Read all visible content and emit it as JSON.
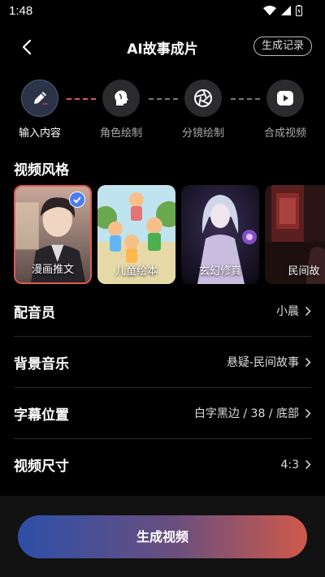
{
  "status_bar": {
    "time": "1:48"
  },
  "header": {
    "title": "AI故事成片",
    "history_label": "生成记录"
  },
  "steps": [
    {
      "label": "输入内容",
      "active": true
    },
    {
      "label": "角色绘制",
      "active": false
    },
    {
      "label": "分镜绘制",
      "active": false
    },
    {
      "label": "合成视频",
      "active": false
    }
  ],
  "video_style": {
    "title": "视频风格",
    "items": [
      {
        "label": "漫画推文",
        "selected": true
      },
      {
        "label": "儿童绘本",
        "selected": false
      },
      {
        "label": "玄幻修真",
        "selected": false
      },
      {
        "label": "民间故",
        "selected": false
      }
    ]
  },
  "settings": [
    {
      "label": "配音员",
      "value": "小晨"
    },
    {
      "label": "背景音乐",
      "value": "悬疑-民间故事"
    },
    {
      "label": "字幕位置",
      "value": "白字黑边 / 38 / 底部"
    },
    {
      "label": "视频尺寸",
      "value": "4:3"
    }
  ],
  "generate_button": {
    "label": "生成视频"
  },
  "colors": {
    "accent_red": "#e05a4e",
    "accent_blue": "#4d7cf0",
    "background": "#000000"
  }
}
